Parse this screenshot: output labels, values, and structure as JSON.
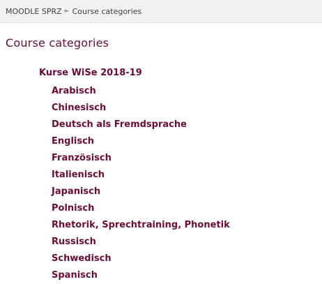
{
  "breadcrumb": {
    "home_label": "MOODLE SPRZ",
    "separator": "►",
    "current_label": "Course categories"
  },
  "page": {
    "title": "Course categories"
  },
  "categories": {
    "parent_label": "Kurse WiSe 2018-19",
    "subcategories": [
      "Arabisch",
      "Chinesisch",
      "Deutsch als Fremdsprache",
      "Englisch",
      "Französisch",
      "Italienisch",
      "Japanisch",
      "Polnisch",
      "Rhetorik, Sprechtraining, Phonetik",
      "Russisch",
      "Schwedisch",
      "Spanisch"
    ]
  },
  "colors": {
    "link": "#6b0b38",
    "breadcrumb_bg": "#f2f2f2"
  }
}
